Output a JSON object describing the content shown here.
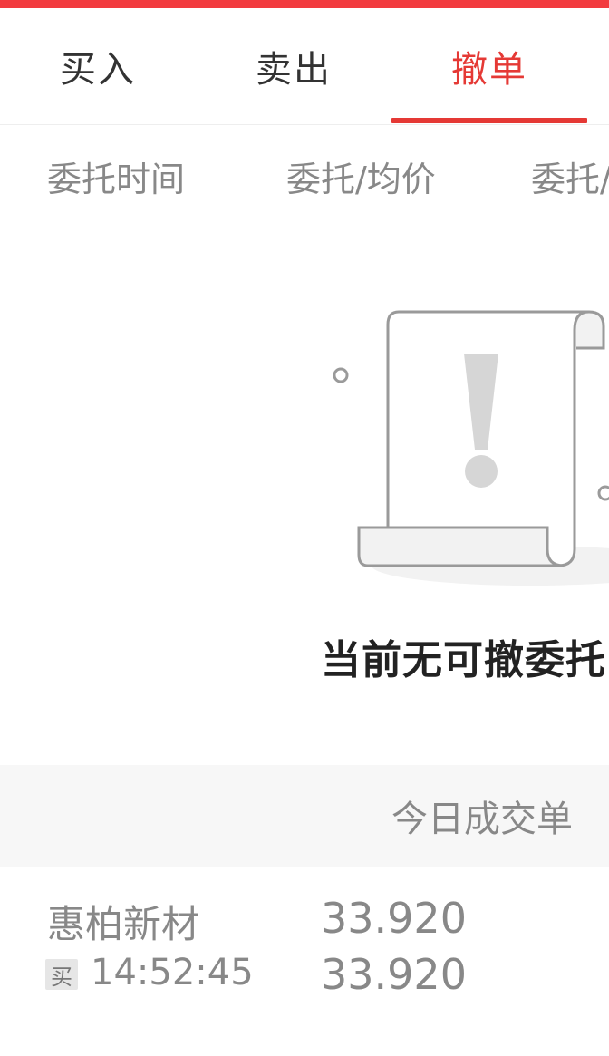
{
  "colors": {
    "accent": "#e53935",
    "top_bar": "#f23b3f",
    "tab_text": "#333333",
    "muted_text": "#888888",
    "illustration_stroke": "#9a9a9a",
    "illustration_fill": "#f2f2f2"
  },
  "tabs": [
    {
      "label": "买入",
      "active": false
    },
    {
      "label": "卖出",
      "active": false
    },
    {
      "label": "撤单",
      "active": true
    }
  ],
  "columns": [
    "委托时间",
    "委托/均价",
    "委托/"
  ],
  "empty_state": {
    "icon": "document-warning-icon",
    "message": "当前无可撤委托"
  },
  "today": {
    "title": "今日成交单"
  },
  "trades": [
    {
      "name": "惠柏新材",
      "side": "买",
      "time": "14:52:45",
      "price_1": "33.920",
      "price_2": "33.920"
    }
  ]
}
